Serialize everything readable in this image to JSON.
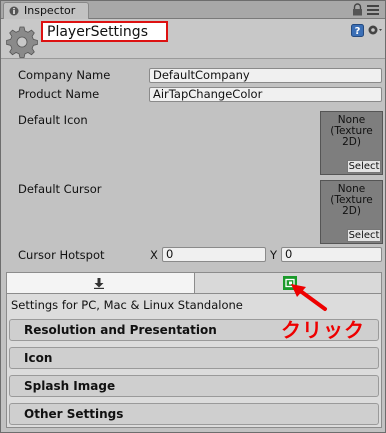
{
  "tab": {
    "label": "Inspector"
  },
  "header": {
    "object_title": "PlayerSettings"
  },
  "properties": {
    "company_name_label": "Company Name",
    "company_name_value": "DefaultCompany",
    "product_name_label": "Product Name",
    "product_name_value": "AirTapChangeColor",
    "default_icon_label": "Default Icon",
    "default_cursor_label": "Default Cursor",
    "object_field_text_1": "None",
    "object_field_text_2": "(Texture",
    "object_field_text_3": "2D)",
    "select_label": "Select",
    "cursor_hotspot_label": "Cursor Hotspot",
    "x_label": "X",
    "x_value": "0",
    "y_label": "Y",
    "y_value": "0"
  },
  "platforms": {
    "settings_for": "Settings for PC, Mac & Linux Standalone",
    "sections": [
      "Resolution and Presentation",
      "Icon",
      "Splash Image",
      "Other Settings"
    ]
  },
  "annotation": {
    "text": "クリック",
    "color": "#ee0000"
  },
  "colors": {
    "highlight_border": "#dd1111",
    "windows_store_green": "#1a9a2a"
  }
}
